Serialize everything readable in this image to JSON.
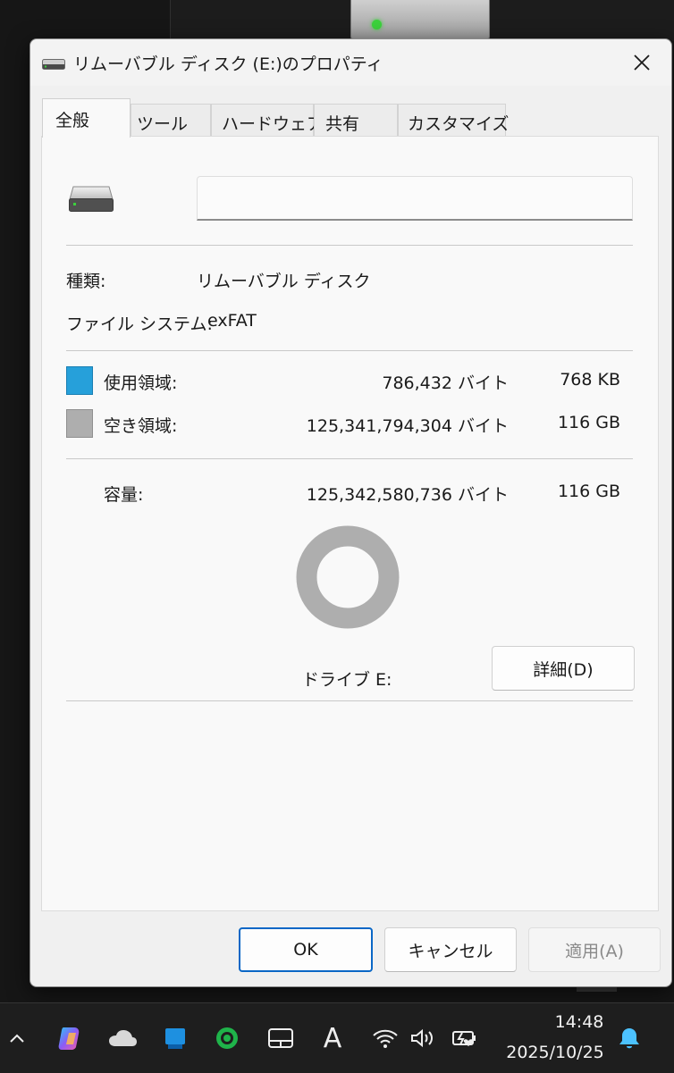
{
  "dialog": {
    "title": "リムーバブル ディスク (E:)のプロパティ",
    "tabs": [
      "全般",
      "ツール",
      "ハードウェア",
      "共有",
      "カスタマイズ"
    ],
    "active_tab": "全般",
    "name_value": "",
    "type_label": "種類:",
    "type_value": "リムーバブル ディスク",
    "fs_label": "ファイル システム:",
    "fs_value": "exFAT",
    "used": {
      "label": "使用領域:",
      "bytes": "786,432 バイト",
      "size": "768 KB",
      "color": "#26a0da"
    },
    "free": {
      "label": "空き領域:",
      "bytes": "125,341,794,304 バイト",
      "size": "116 GB",
      "color": "#aeaeae"
    },
    "capacity": {
      "label": "容量:",
      "bytes": "125,342,580,736 バイト",
      "size": "116 GB"
    },
    "used_fraction": 6.3e-06,
    "drive_label": "ドライブ E:",
    "details_button": "詳細(D)",
    "ok_button": "OK",
    "cancel_button": "キャンセル",
    "apply_button": "適用(A)"
  },
  "taskbar": {
    "time": "14:48",
    "date": "2025/10/25",
    "icons": [
      "chevron-up-icon",
      "copilot-icon",
      "onedrive-icon",
      "app-blue-icon",
      "app-green-circle-icon",
      "touchpad-icon",
      "ime-icon",
      "wifi-icon",
      "volume-icon",
      "battery-icon",
      "notification-bell-icon"
    ],
    "ime_glyph": "A"
  }
}
